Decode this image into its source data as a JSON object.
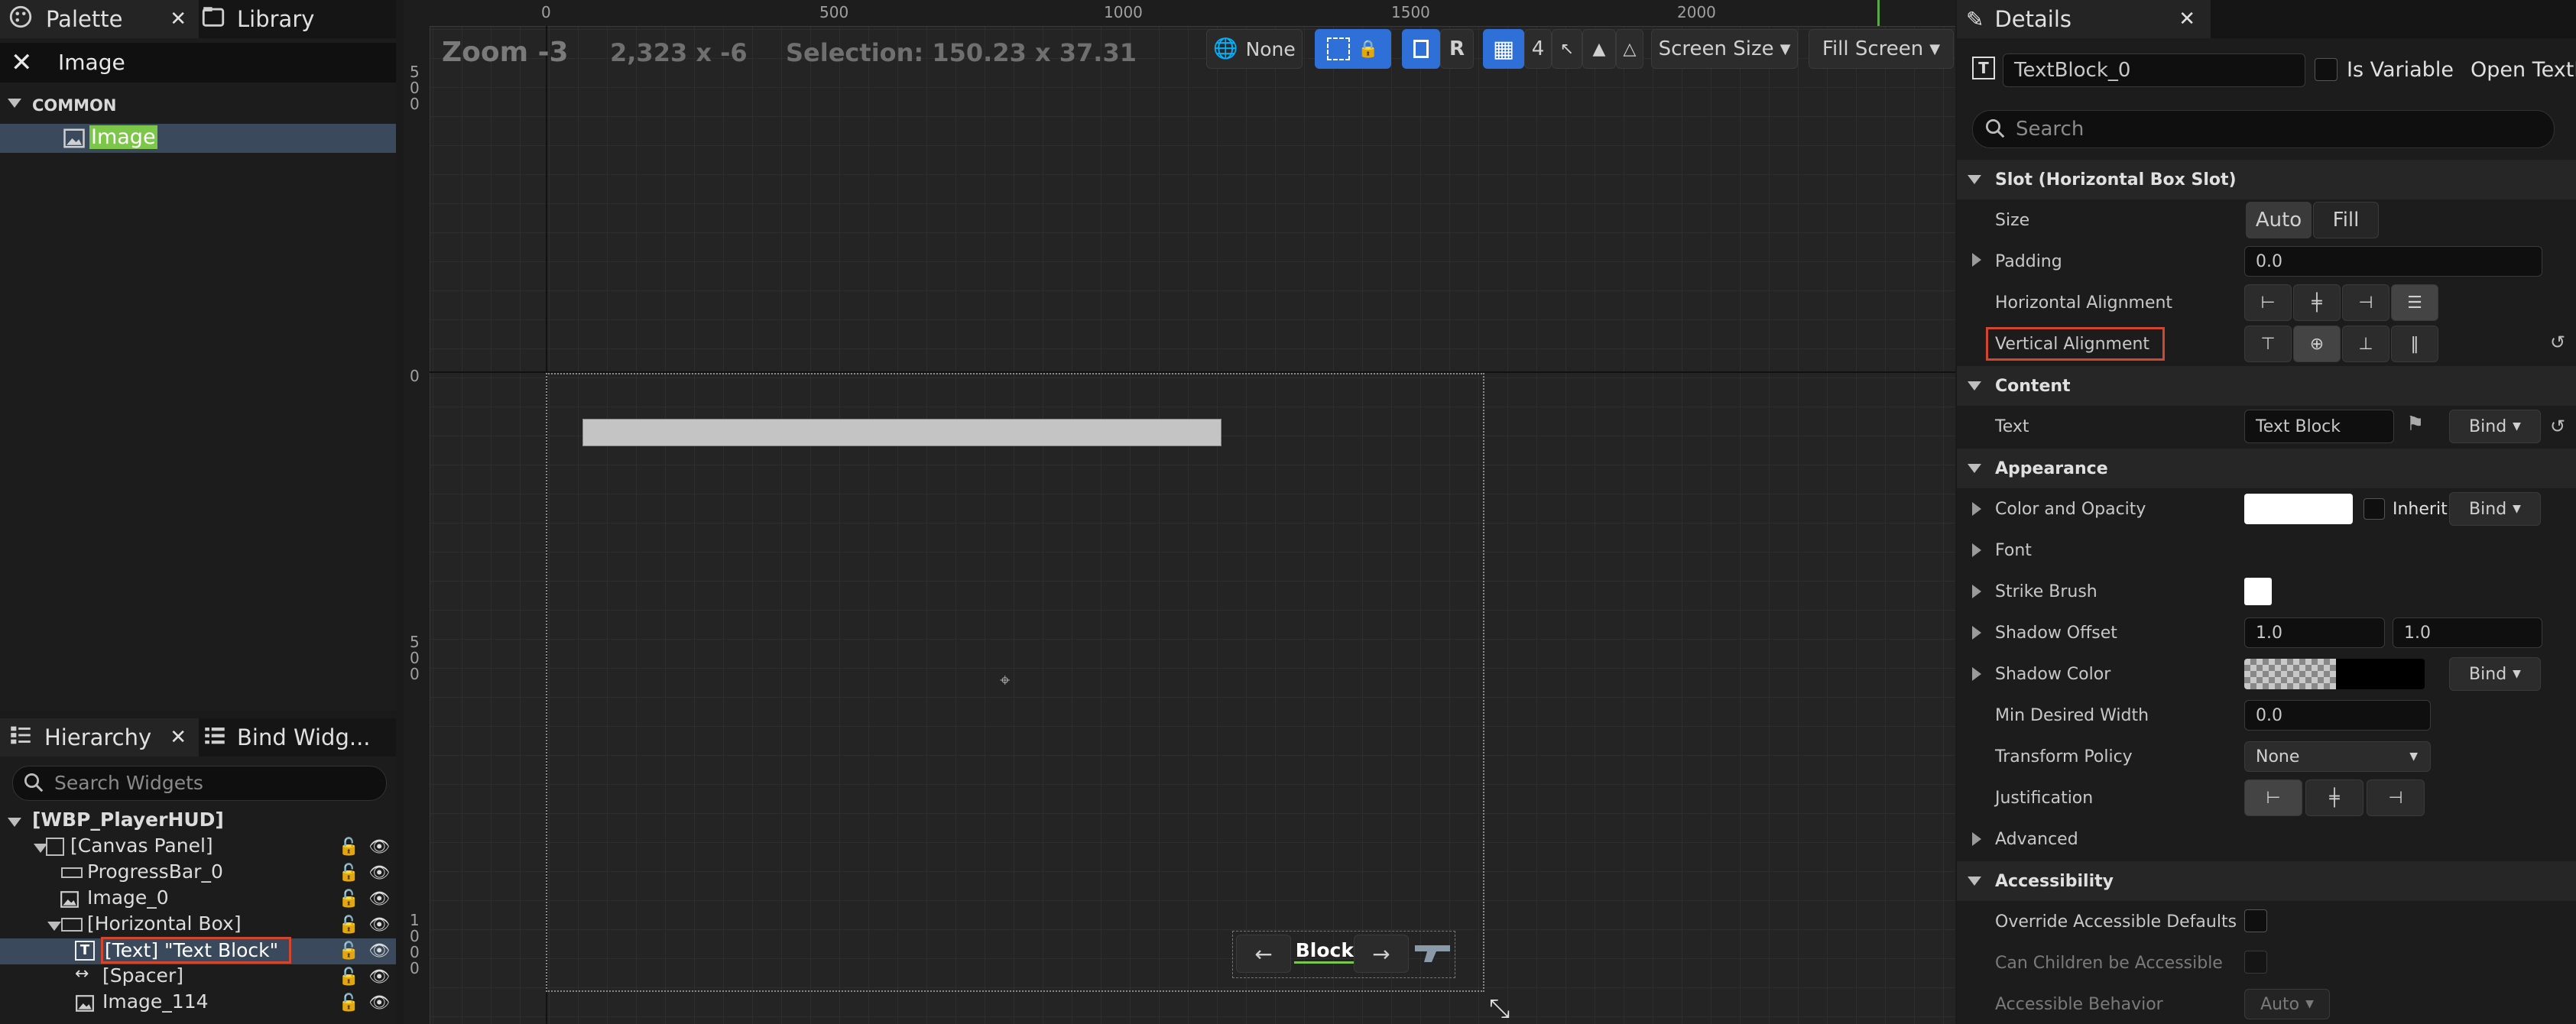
{
  "palette": {
    "tab_palette": "Palette",
    "tab_library": "Library",
    "search_value": "Image",
    "category": "COMMON",
    "item": "Image"
  },
  "hierarchy": {
    "tab_hierarchy": "Hierarchy",
    "tab_bind": "Bind Widg...",
    "search_placeholder": "Search Widgets",
    "items": [
      {
        "label": "[WBP_PlayerHUD]"
      },
      {
        "label": "[Canvas Panel]"
      },
      {
        "label": "ProgressBar_0"
      },
      {
        "label": "Image_0"
      },
      {
        "label": "[Horizontal Box]"
      },
      {
        "label": "[Text] \"Text Block\""
      },
      {
        "label": "[Spacer]"
      },
      {
        "label": "Image_114"
      }
    ]
  },
  "viewport": {
    "zoom": "Zoom -3",
    "coords": "2,323 x -6",
    "selection": "Selection: 150.23 x 37.31",
    "none_label": "None",
    "r_label": "R",
    "grid_count": "4",
    "screen_size": "Screen Size",
    "fill_screen": "Fill Screen",
    "ruler_top": [
      "0",
      "500",
      "1000",
      "1500",
      "2000"
    ],
    "ruler_left": [
      "500",
      "0",
      "500",
      "1000"
    ],
    "hbox_text": "xt Block",
    "arrow_left": "←",
    "arrow_right": "→"
  },
  "details": {
    "tab": "Details",
    "name": "TextBlock_0",
    "is_variable": "Is Variable",
    "open_textblock": "Open TextB",
    "search_placeholder": "Search",
    "slot_section": "Slot (Horizontal Box Slot)",
    "size_label": "Size",
    "size_auto": "Auto",
    "size_fill": "Fill",
    "padding_label": "Padding",
    "padding_value": "0.0",
    "halign_label": "Horizontal Alignment",
    "valign_label": "Vertical Alignment",
    "content_section": "Content",
    "text_label": "Text",
    "text_value": "Text Block",
    "bind": "Bind",
    "appearance_section": "Appearance",
    "color_label": "Color and Opacity",
    "inherit": "Inherit",
    "font_label": "Font",
    "strike_label": "Strike Brush",
    "shadow_offset_label": "Shadow Offset",
    "shadow_offset_x": "1.0",
    "shadow_offset_y": "1.0",
    "shadow_color_label": "Shadow Color",
    "min_width_label": "Min Desired Width",
    "min_width_value": "0.0",
    "transform_label": "Transform Policy",
    "transform_value": "None",
    "justification_label": "Justification",
    "advanced_label": "Advanced",
    "accessibility_section": "Accessibility",
    "override_label": "Override Accessible Defaults",
    "children_label": "Can Children be Accessible",
    "behavior_label": "Accessible Behavior",
    "behavior_value": "Auto"
  },
  "colors": {
    "accent": "#2f6fd8",
    "highlight_red": "#d0462f",
    "palette_match": "#7cc64a"
  }
}
